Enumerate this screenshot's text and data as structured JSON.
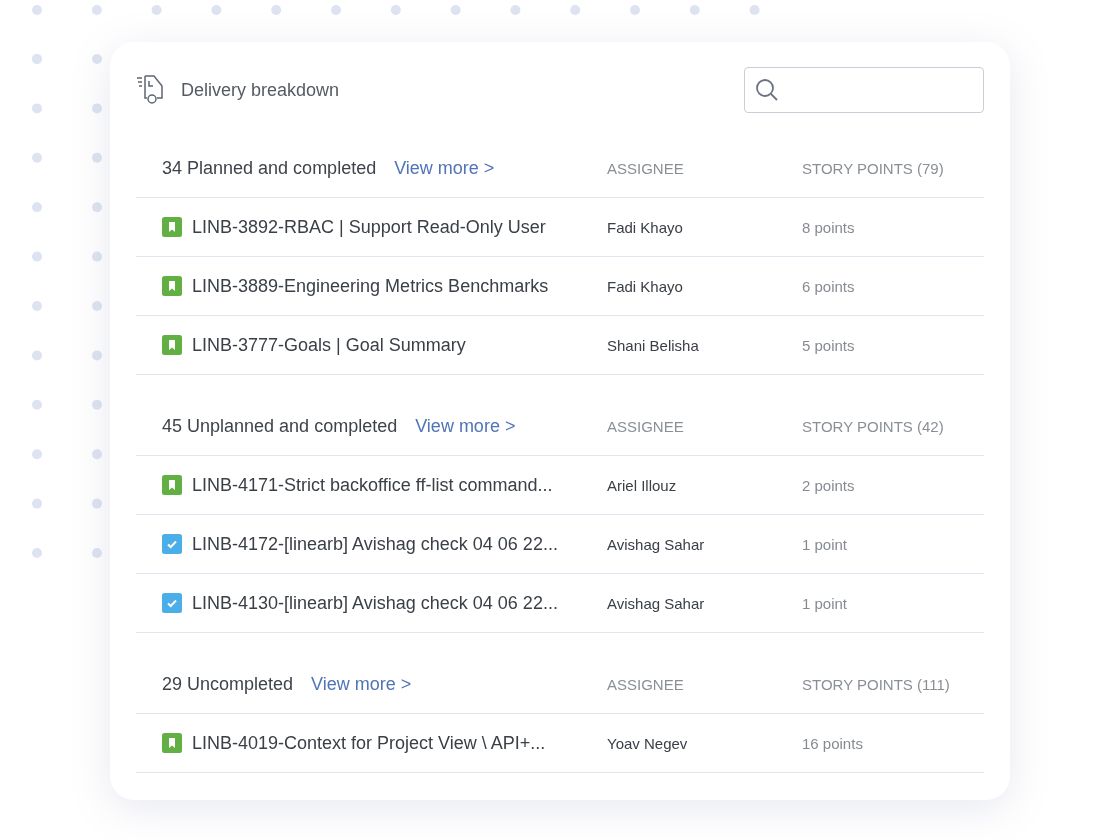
{
  "header": {
    "title": "Delivery breakdown"
  },
  "sections": [
    {
      "title": "34 Planned and completed",
      "link": "View more >",
      "columns": [
        "ASSIGNEE",
        "STORY POINTS (79)"
      ],
      "rows": [
        {
          "kind": "story",
          "title": "LINB-3892-RBAC | Support Read-Only User",
          "assignee": "Fadi Khayo",
          "points": "8 points"
        },
        {
          "kind": "story",
          "title": "LINB-3889-Engineering Metrics Benchmarks",
          "assignee": "Fadi Khayo",
          "points": "6 points"
        },
        {
          "kind": "story",
          "title": "LINB-3777-Goals | Goal Summary",
          "assignee": "Shani Belisha",
          "points": "5 points"
        }
      ]
    },
    {
      "title": "45 Unplanned and completed",
      "link": "View more >",
      "columns": [
        "ASSIGNEE",
        "STORY POINTS (42)"
      ],
      "rows": [
        {
          "kind": "story",
          "title": "LINB-4171-Strict backoffice ff-list command...",
          "assignee": "Ariel Illouz",
          "points": "2 points"
        },
        {
          "kind": "task",
          "title": "LINB-4172-[linearb] Avishag check 04 06 22...",
          "assignee": "Avishag Sahar",
          "points": "1 point"
        },
        {
          "kind": "task",
          "title": "LINB-4130-[linearb] Avishag check 04 06 22...",
          "assignee": "Avishag Sahar",
          "points": "1 point"
        }
      ]
    },
    {
      "title": "29 Uncompleted",
      "link": "View more >",
      "columns": [
        "ASSIGNEE",
        "STORY POINTS (111)"
      ],
      "rows": [
        {
          "kind": "story",
          "title": "LINB-4019-Context for Project View \\ API+...",
          "assignee": "Yoav Negev",
          "points": "16 points"
        }
      ]
    }
  ]
}
